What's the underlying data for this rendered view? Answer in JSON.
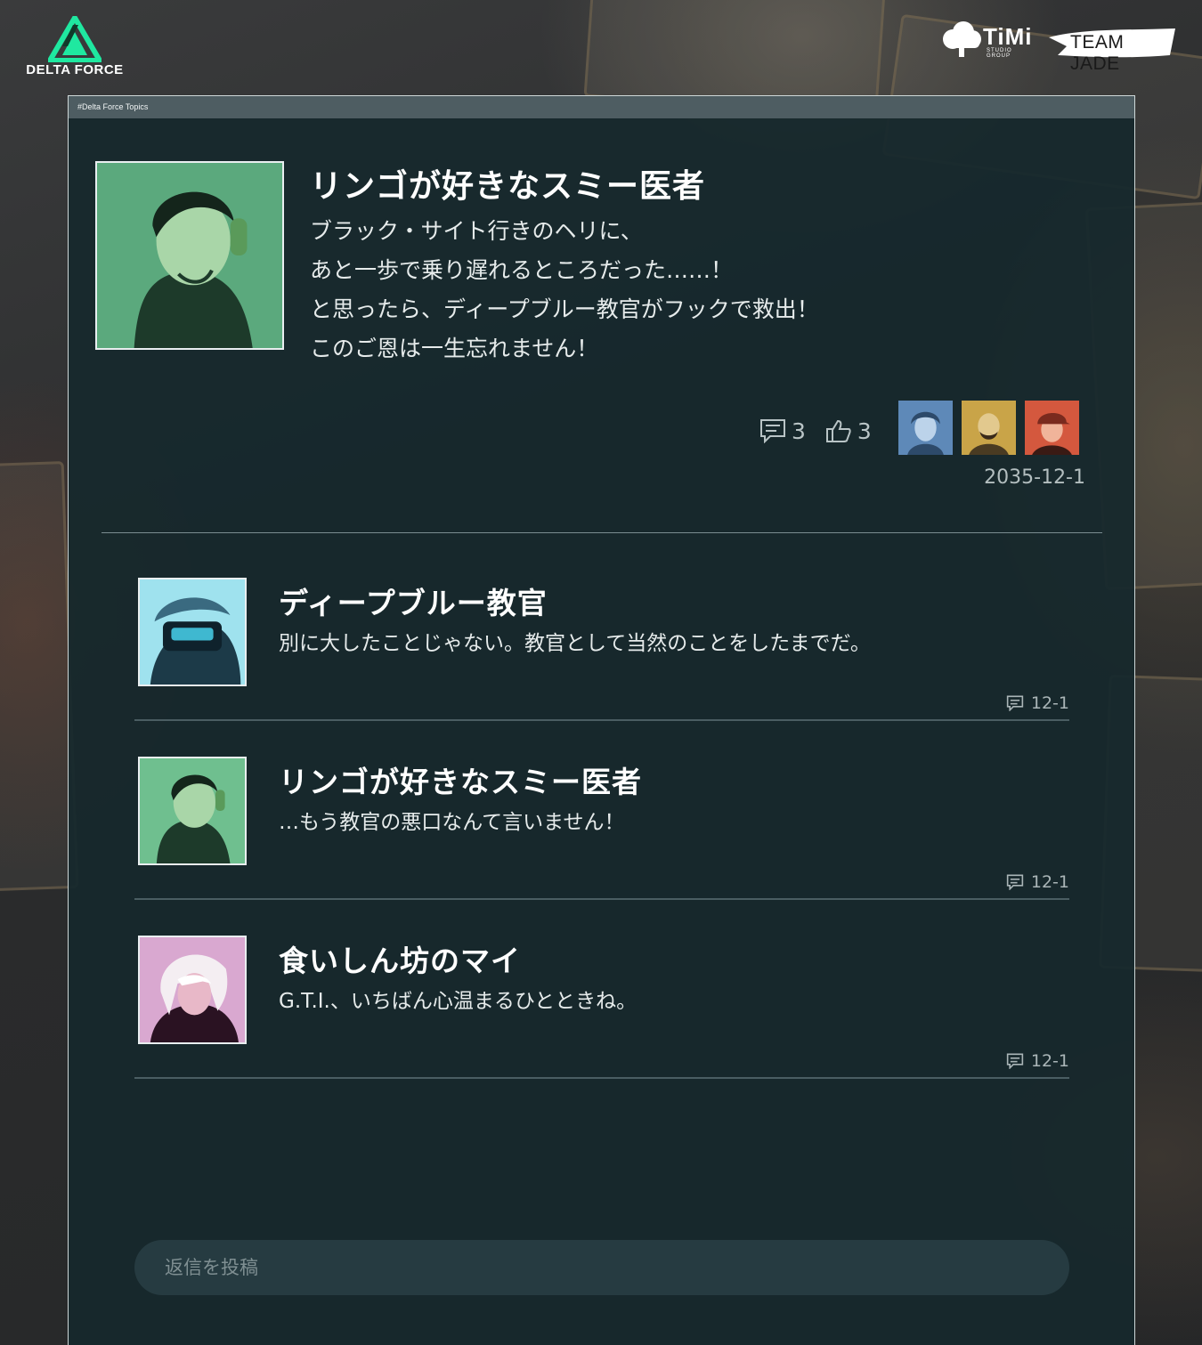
{
  "brand": {
    "game_logo": "DELTA FORCE",
    "studio_logo": "TiMi",
    "studio_logo_sub": "STUDIO GROUP",
    "team_logo": "TEAM JADE",
    "accent_color": "#1fe8a0"
  },
  "panel": {
    "topic_tag": "#Delta Force Topics"
  },
  "post": {
    "author": "リンゴが好きなスミー医者",
    "lines": [
      "ブラック・サイト行きのヘリに、",
      "あと一歩で乗り遅れるところだった……！",
      "と思ったら、ディープブルー教官がフックで救出！",
      "このご恩は一生忘れません！"
    ],
    "comment_count": "3",
    "like_count": "3",
    "date": "2035-12-1",
    "comment_icon": "comment-icon",
    "like_icon": "thumbs-up-icon"
  },
  "replies": [
    {
      "author": "ディープブルー教官",
      "text": "別に大したことじゃない。教官として当然のことをしたまでだ。",
      "date": "12-1",
      "avatar_color": "#6fc6d4"
    },
    {
      "author": "リンゴが好きなスミー医者",
      "text": "…もう教官の悪口なんて言いません！",
      "date": "12-1",
      "avatar_color": "#4a9a6e"
    },
    {
      "author": "食いしん坊のマイ",
      "text": "G.T.I.、いちばん心温まるひとときね。",
      "date": "12-1",
      "avatar_color": "#d49ac4"
    }
  ],
  "reply_box": {
    "placeholder": "返信を投稿"
  }
}
